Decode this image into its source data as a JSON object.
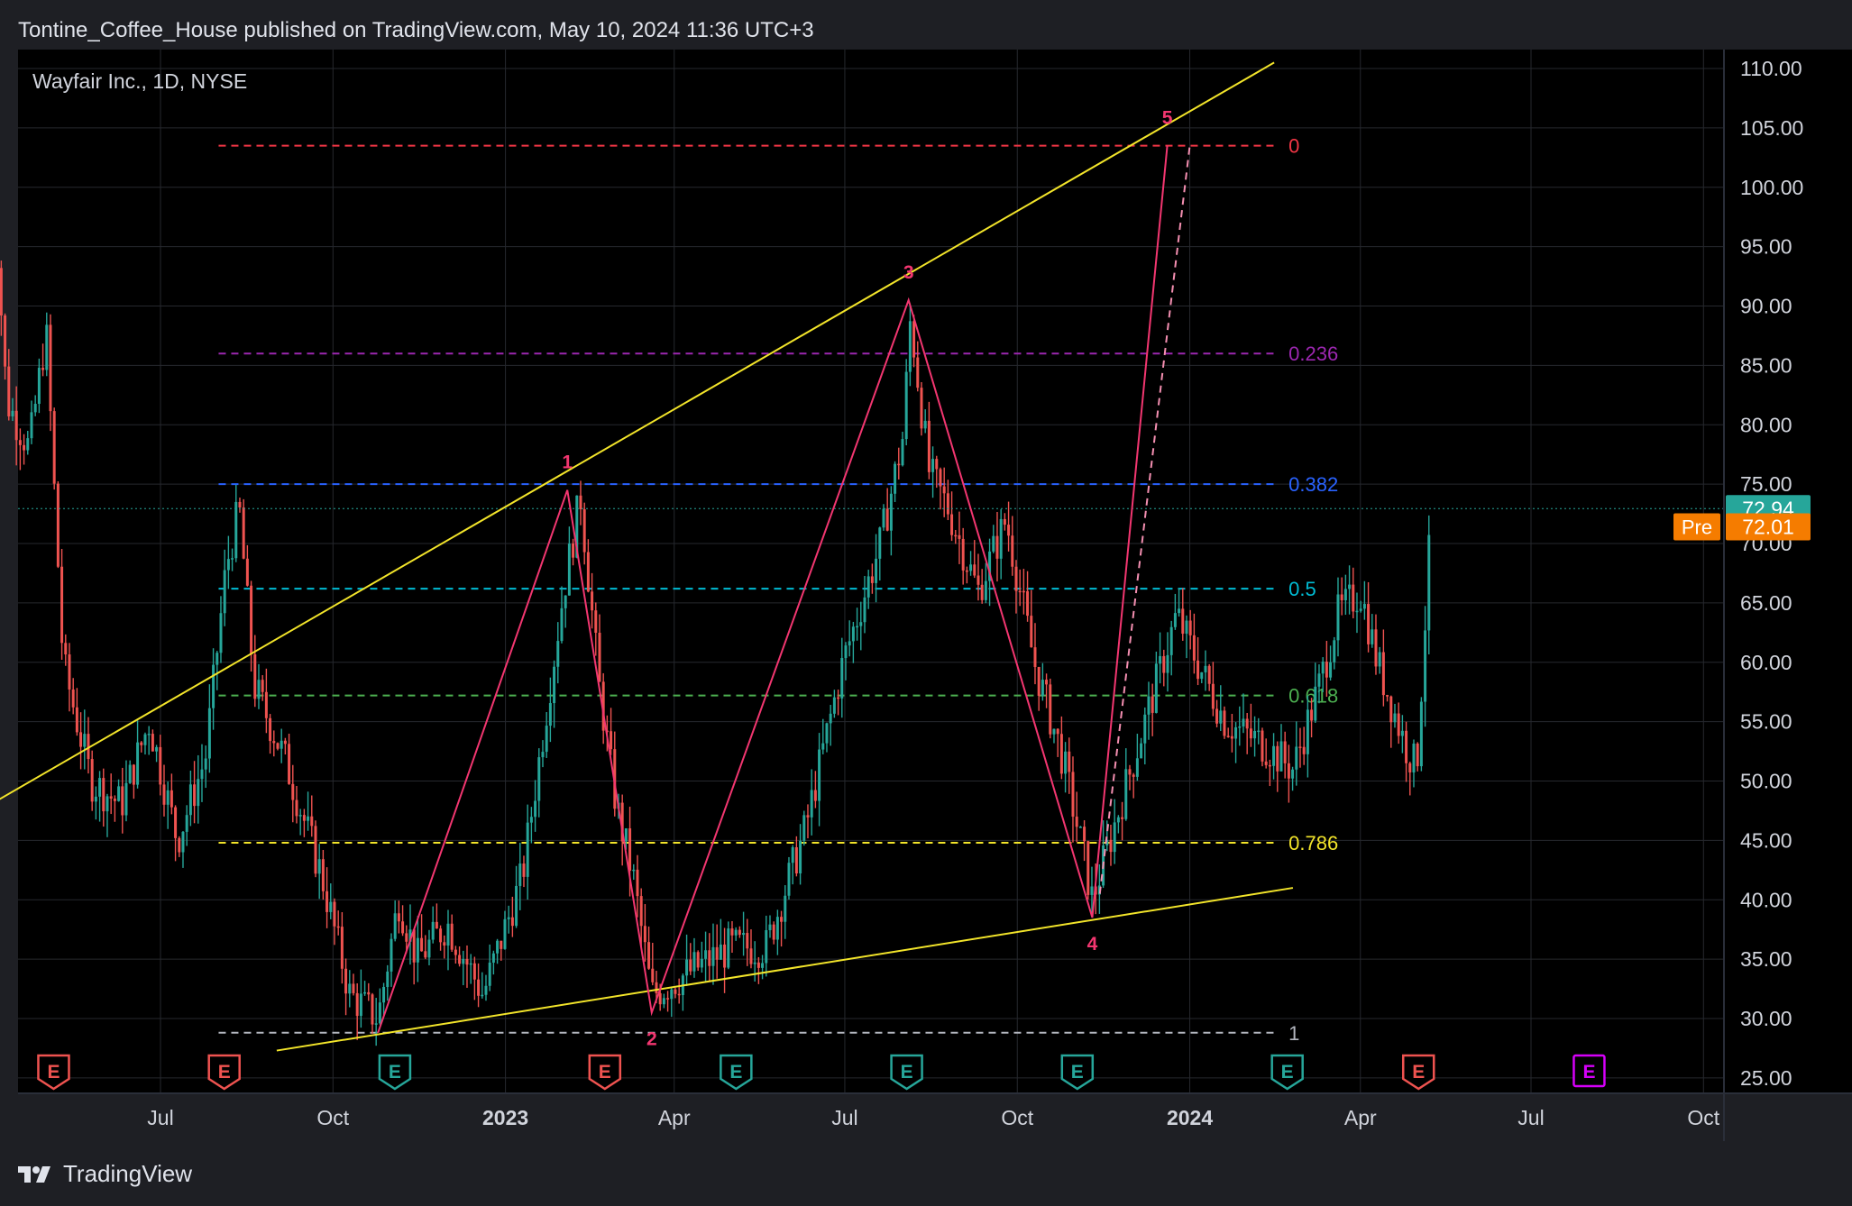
{
  "header": {
    "publish_line": "Tontine_Coffee_House published on TradingView.com, May 10, 2024 11:36 UTC+3"
  },
  "footer": {
    "brand": "TradingView"
  },
  "colors": {
    "background": "#000000",
    "frame": "#1e1f24",
    "grid": "#26282e",
    "axis_text": "#d1d4dc",
    "up": "#26a69a",
    "down": "#ef5350",
    "wave": "#f23670",
    "trend": "#f2e42a",
    "last_price_badge": "#26a69a",
    "pre_badge": "#f57c00",
    "earnings_past_red": "#ef5350",
    "earnings_past_green": "#26a69a",
    "earnings_future": "#d500f9"
  },
  "chart_data": {
    "type": "candlestick",
    "title": "Wayfair Inc., 1D, NYSE",
    "ylim": [
      23,
      113
    ],
    "y_ticks": [
      "110.00",
      "105.00",
      "100.00",
      "95.00",
      "90.00",
      "85.00",
      "80.00",
      "75.00",
      "70.00",
      "65.00",
      "60.00",
      "55.00",
      "50.00",
      "45.00",
      "40.00",
      "35.00",
      "30.00",
      "25.00"
    ],
    "x_ticks": [
      {
        "label": "Jul",
        "date": "2022-07-01",
        "bold": false
      },
      {
        "label": "Oct",
        "date": "2022-10-01",
        "bold": false
      },
      {
        "label": "2023",
        "date": "2023-01-01",
        "bold": true
      },
      {
        "label": "Apr",
        "date": "2023-04-01",
        "bold": false
      },
      {
        "label": "Jul",
        "date": "2023-07-01",
        "bold": false
      },
      {
        "label": "Oct",
        "date": "2023-10-01",
        "bold": false
      },
      {
        "label": "2024",
        "date": "2024-01-01",
        "bold": true
      },
      {
        "label": "Apr",
        "date": "2024-04-01",
        "bold": false
      },
      {
        "label": "Jul",
        "date": "2024-07-01",
        "bold": false
      },
      {
        "label": "Oct",
        "date": "2024-10-01",
        "bold": false
      }
    ],
    "price_path": [
      [
        "2022-04-01",
        105
      ],
      [
        "2022-04-10",
        82
      ],
      [
        "2022-04-22",
        78
      ],
      [
        "2022-05-01",
        88
      ],
      [
        "2022-05-10",
        60
      ],
      [
        "2022-05-25",
        50
      ],
      [
        "2022-06-10",
        48
      ],
      [
        "2022-06-25",
        55
      ],
      [
        "2022-07-10",
        45
      ],
      [
        "2022-07-25",
        52
      ],
      [
        "2022-08-05",
        68
      ],
      [
        "2022-08-12",
        73
      ],
      [
        "2022-08-20",
        58
      ],
      [
        "2022-09-05",
        52
      ],
      [
        "2022-09-25",
        42
      ],
      [
        "2022-10-10",
        32
      ],
      [
        "2022-10-25",
        30
      ],
      [
        "2022-11-05",
        40
      ],
      [
        "2022-11-15",
        35
      ],
      [
        "2022-12-01",
        38
      ],
      [
        "2022-12-20",
        32
      ],
      [
        "2023-01-10",
        42
      ],
      [
        "2023-02-01",
        66
      ],
      [
        "2023-02-10",
        74
      ],
      [
        "2023-02-20",
        58
      ],
      [
        "2023-03-01",
        48
      ],
      [
        "2023-03-10",
        42
      ],
      [
        "2023-03-20",
        32
      ],
      [
        "2023-04-10",
        34
      ],
      [
        "2023-05-01",
        36
      ],
      [
        "2023-05-20",
        36
      ],
      [
        "2023-06-10",
        46
      ],
      [
        "2023-06-30",
        60
      ],
      [
        "2023-07-20",
        70
      ],
      [
        "2023-08-01",
        79
      ],
      [
        "2023-08-05",
        89
      ],
      [
        "2023-08-15",
        76
      ],
      [
        "2023-08-25",
        73
      ],
      [
        "2023-09-10",
        66
      ],
      [
        "2023-09-25",
        72
      ],
      [
        "2023-10-10",
        60
      ],
      [
        "2023-10-25",
        52
      ],
      [
        "2023-11-05",
        44
      ],
      [
        "2023-11-10",
        40
      ],
      [
        "2023-11-25",
        48
      ],
      [
        "2023-12-10",
        56
      ],
      [
        "2023-12-25",
        64
      ],
      [
        "2024-01-05",
        60
      ],
      [
        "2024-01-20",
        55
      ],
      [
        "2024-02-10",
        53
      ],
      [
        "2024-02-25",
        51
      ],
      [
        "2024-03-10",
        58
      ],
      [
        "2024-03-20",
        64
      ],
      [
        "2024-04-01",
        66
      ],
      [
        "2024-04-10",
        60
      ],
      [
        "2024-04-25",
        53
      ],
      [
        "2024-05-01",
        51
      ],
      [
        "2024-05-05",
        62
      ],
      [
        "2024-05-09",
        73
      ]
    ],
    "last_price": "72.94",
    "pre_market": {
      "label": "Pre",
      "value": "72.01"
    },
    "fib_levels": [
      {
        "label": "0",
        "price": 103.5,
        "color": "#f23645"
      },
      {
        "label": "0.236",
        "price": 86,
        "color": "#9c27b0"
      },
      {
        "label": "0.382",
        "price": 75,
        "color": "#2962ff"
      },
      {
        "label": "0.5",
        "price": 66.2,
        "color": "#00bcd4"
      },
      {
        "label": "0.618",
        "price": 57.2,
        "color": "#4caf50"
      },
      {
        "label": "0.786",
        "price": 44.8,
        "color": "#f2e42a"
      },
      {
        "label": "1",
        "price": 28.8,
        "color": "#b2b5be"
      }
    ],
    "fib_span": [
      "2022-08-01",
      "2024-02-15"
    ],
    "waves": [
      {
        "label": "1",
        "date": "2023-02-03",
        "price": 74.5
      },
      {
        "label": "2",
        "date": "2023-03-20",
        "price": 30.5
      },
      {
        "label": "3",
        "date": "2023-08-04",
        "price": 90.5
      },
      {
        "label": "4",
        "date": "2023-11-10",
        "price": 38.5
      },
      {
        "label": "5",
        "date": "2023-12-20",
        "price": 103.5
      }
    ],
    "wave_start": {
      "date": "2022-10-25",
      "price": 28.8
    },
    "projection_base": {
      "date": "2023-11-14",
      "price": 40.5
    },
    "projection_tip": {
      "date": "2024-01-01",
      "price": 103.5
    },
    "trendlines": [
      {
        "from": [
          "2022-04-01",
          48
        ],
        "to": [
          "2024-02-15",
          110.5
        ]
      },
      {
        "from": [
          "2022-09-01",
          27.3
        ],
        "to": [
          "2024-02-25",
          41
        ]
      }
    ],
    "earnings": [
      {
        "date": "2022-05-05",
        "color": "red"
      },
      {
        "date": "2022-08-04",
        "color": "red"
      },
      {
        "date": "2022-11-03",
        "color": "green"
      },
      {
        "date": "2023-02-23",
        "color": "red"
      },
      {
        "date": "2023-05-04",
        "color": "green"
      },
      {
        "date": "2023-08-03",
        "color": "green"
      },
      {
        "date": "2023-11-02",
        "color": "green"
      },
      {
        "date": "2024-02-22",
        "color": "green"
      },
      {
        "date": "2024-05-02",
        "color": "red"
      },
      {
        "date": "2024-08-01",
        "color": "future"
      }
    ]
  }
}
